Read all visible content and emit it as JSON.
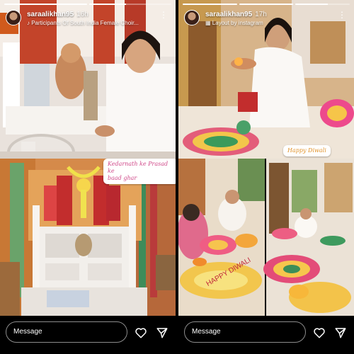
{
  "stories": {
    "left": {
      "username": "saraalikhan95",
      "time": "16h",
      "subtitle": "♪ Participants Of South India Female Choir...",
      "sticker": "Kedarnath ke Prasad ke\nbaad ghar",
      "message_placeholder": "Message",
      "progress": [
        1,
        0.45
      ]
    },
    "right": {
      "username": "saraalikhan95",
      "time": "17h",
      "subtitle": "Layout by instagram",
      "sticker": "Happy Diwali",
      "message_placeholder": "Message",
      "progress": [
        1,
        1,
        0.6
      ]
    }
  },
  "icons": {
    "more": "more-dots-icon",
    "heart": "heart-icon",
    "send": "send-icon",
    "layout": "layout-grid-icon",
    "music": "music-note-icon"
  },
  "colors": {
    "background": "#000000",
    "sticker_text": "#d04a8a"
  }
}
